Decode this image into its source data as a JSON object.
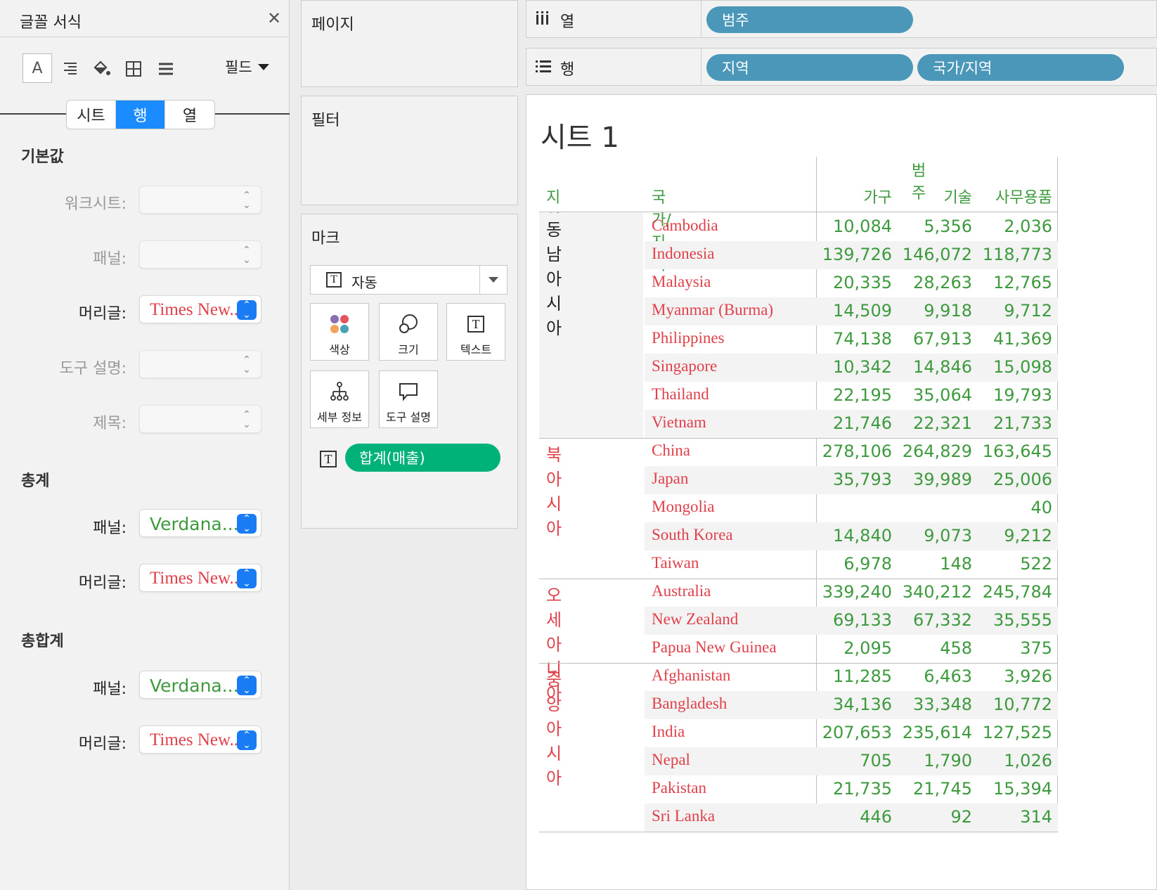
{
  "format_pane": {
    "title": "글꼴 서식",
    "close_icon": "✕",
    "field_label": "필드",
    "tabs": [
      {
        "label": "시트",
        "active": false
      },
      {
        "label": "행",
        "active": true
      },
      {
        "label": "열",
        "active": false
      }
    ],
    "sections": {
      "default": {
        "title": "기본값",
        "rows": [
          {
            "label": "워크시트:",
            "value": "",
            "enabled": false
          },
          {
            "label": "패널:",
            "value": "",
            "enabled": false
          },
          {
            "label": "머리글:",
            "value": "Times New...",
            "font": "serif",
            "enabled": true
          },
          {
            "label": "도구 설명:",
            "value": "",
            "enabled": false
          },
          {
            "label": "제목:",
            "value": "",
            "enabled": false
          }
        ]
      },
      "totals": {
        "title": "총계",
        "rows": [
          {
            "label": "패널:",
            "value": "Verdana...",
            "font": "verdana",
            "enabled": true
          },
          {
            "label": "머리글:",
            "value": "Times New...",
            "font": "serif",
            "enabled": true
          }
        ]
      },
      "grand_totals": {
        "title": "총합계",
        "rows": [
          {
            "label": "패널:",
            "value": "Verdana...",
            "font": "verdana",
            "enabled": true
          },
          {
            "label": "머리글:",
            "value": "Times New...",
            "font": "serif",
            "enabled": true
          }
        ]
      }
    }
  },
  "cards": {
    "pages": "페이지",
    "filters": "필터",
    "marks": {
      "title": "마크",
      "type": "자동",
      "buttons": {
        "color": "색상",
        "size": "크기",
        "text": "텍스트",
        "detail": "세부 정보",
        "tooltip": "도구 설명"
      },
      "pill": "합계(매출)"
    }
  },
  "shelves": {
    "columns": {
      "label": "열",
      "pills": [
        "범주"
      ]
    },
    "rows": {
      "label": "행",
      "pills": [
        "지역",
        "국가/지역"
      ]
    }
  },
  "colors": {
    "accent_blue": "#1a8cff",
    "pill_blue": "#4a97b9",
    "pill_green": "#00b27a",
    "header_green": "#3d9a3d",
    "country_red": "#e0404a"
  },
  "view": {
    "sheet_title": "시트 1",
    "headers": {
      "region": "지역",
      "country": "국가/지역",
      "category_group": "범주",
      "categories": [
        "가구",
        "기술",
        "사무용품"
      ]
    },
    "groups": [
      {
        "region": "동남아시아",
        "region_color": "#222222",
        "rows": [
          {
            "country": "Cambodia",
            "values": [
              "10,084",
              "5,356",
              "2,036"
            ]
          },
          {
            "country": "Indonesia",
            "values": [
              "139,726",
              "146,072",
              "118,773"
            ]
          },
          {
            "country": "Malaysia",
            "values": [
              "20,335",
              "28,263",
              "12,765"
            ]
          },
          {
            "country": "Myanmar (Burma)",
            "values": [
              "14,509",
              "9,918",
              "9,712"
            ]
          },
          {
            "country": "Philippines",
            "values": [
              "74,138",
              "67,913",
              "41,369"
            ]
          },
          {
            "country": "Singapore",
            "values": [
              "10,342",
              "14,846",
              "15,098"
            ]
          },
          {
            "country": "Thailand",
            "values": [
              "22,195",
              "35,064",
              "19,793"
            ]
          },
          {
            "country": "Vietnam",
            "values": [
              "21,746",
              "22,321",
              "21,733"
            ]
          }
        ]
      },
      {
        "region": "북아시아",
        "region_color": "#e0404a",
        "rows": [
          {
            "country": "China",
            "values": [
              "278,106",
              "264,829",
              "163,645"
            ]
          },
          {
            "country": "Japan",
            "values": [
              "35,793",
              "39,989",
              "25,006"
            ]
          },
          {
            "country": "Mongolia",
            "values": [
              "",
              "",
              "40"
            ]
          },
          {
            "country": "South Korea",
            "values": [
              "14,840",
              "9,073",
              "9,212"
            ]
          },
          {
            "country": "Taiwan",
            "values": [
              "6,978",
              "148",
              "522"
            ]
          }
        ]
      },
      {
        "region": "오세아니아",
        "region_color": "#e0404a",
        "rows": [
          {
            "country": "Australia",
            "values": [
              "339,240",
              "340,212",
              "245,784"
            ]
          },
          {
            "country": "New Zealand",
            "values": [
              "69,133",
              "67,332",
              "35,555"
            ]
          },
          {
            "country": "Papua New Guinea",
            "values": [
              "2,095",
              "458",
              "375"
            ]
          }
        ]
      },
      {
        "region": "중앙아시아",
        "region_color": "#e0404a",
        "rows": [
          {
            "country": "Afghanistan",
            "values": [
              "11,285",
              "6,463",
              "3,926"
            ]
          },
          {
            "country": "Bangladesh",
            "values": [
              "34,136",
              "33,348",
              "10,772"
            ]
          },
          {
            "country": "India",
            "values": [
              "207,653",
              "235,614",
              "127,525"
            ]
          },
          {
            "country": "Nepal",
            "values": [
              "705",
              "1,790",
              "1,026"
            ]
          },
          {
            "country": "Pakistan",
            "values": [
              "21,735",
              "21,745",
              "15,394"
            ]
          },
          {
            "country": "Sri Lanka",
            "values": [
              "446",
              "92",
              "314"
            ]
          }
        ]
      }
    ]
  }
}
